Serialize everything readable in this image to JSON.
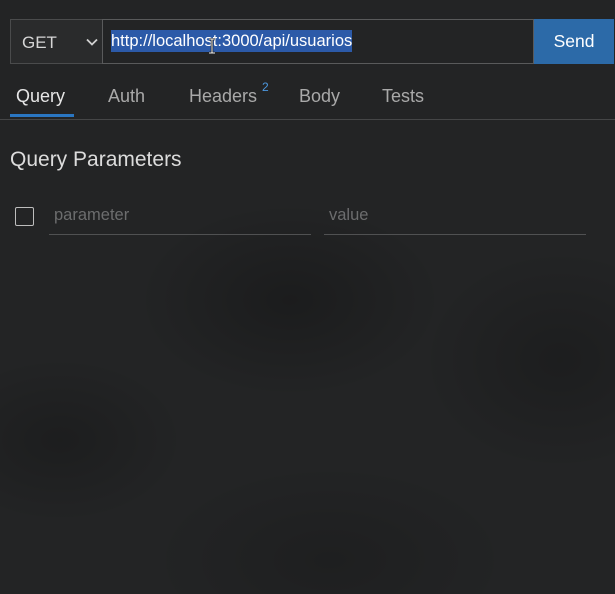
{
  "request": {
    "method": "GET",
    "url": "http://localhost:3000/api/usuarios",
    "send_label": "Send"
  },
  "tabs": [
    {
      "label": "Query",
      "active": true
    },
    {
      "label": "Auth",
      "active": false
    },
    {
      "label": "Headers",
      "badge": "2",
      "active": false
    },
    {
      "label": "Body",
      "active": false
    },
    {
      "label": "Tests",
      "active": false
    }
  ],
  "query": {
    "title": "Query Parameters",
    "rows": [
      {
        "checked": false,
        "parameter_placeholder": "parameter",
        "value_placeholder": "value"
      }
    ]
  },
  "icons": {
    "method_dropdown": "chevron-down-icon",
    "text_cursor": "text-cursor-icon"
  },
  "colors": {
    "accent": "#2c6aa8",
    "selection": "#2c5aa8",
    "badge": "#4c98e0",
    "active_tab_underline": "#2a76c2"
  }
}
